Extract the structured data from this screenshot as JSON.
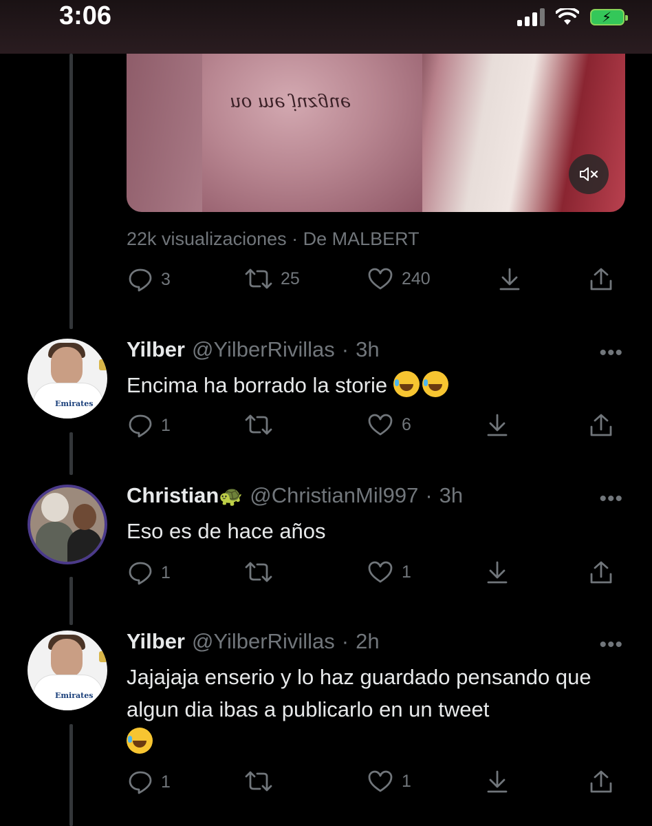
{
  "status_bar": {
    "time": "3:06"
  },
  "tweet": {
    "media_overlay_text": "no me juzgue",
    "views": "22k visualizaciones · De MALBERT",
    "actions": {
      "replies": "3",
      "retweets": "25",
      "likes": "240"
    }
  },
  "replies": [
    {
      "name": "Yilber",
      "emoji_after_name": "",
      "handle": "@YilberRivillas",
      "time": "3h",
      "text": "Encima ha borrado la storie",
      "emojis": [
        "🤣",
        "🤣"
      ],
      "replies": "1",
      "retweets": "",
      "likes": "6"
    },
    {
      "name": "Christian",
      "emoji_after_name": "🐢",
      "handle": "@ChristianMil997",
      "time": "3h",
      "text": "Eso es de hace años",
      "emojis": [],
      "replies": "1",
      "retweets": "",
      "likes": "1"
    },
    {
      "name": "Yilber",
      "emoji_after_name": "",
      "handle": "@YilberRivillas",
      "time": "2h",
      "text": "Jajajaja enserio y lo haz guardado pensando que algun dia ibas a publicarlo en un tweet",
      "emojis": [
        "😂"
      ],
      "replies": "1",
      "retweets": "",
      "likes": "1"
    }
  ],
  "separator": "·",
  "more_label": "•••"
}
